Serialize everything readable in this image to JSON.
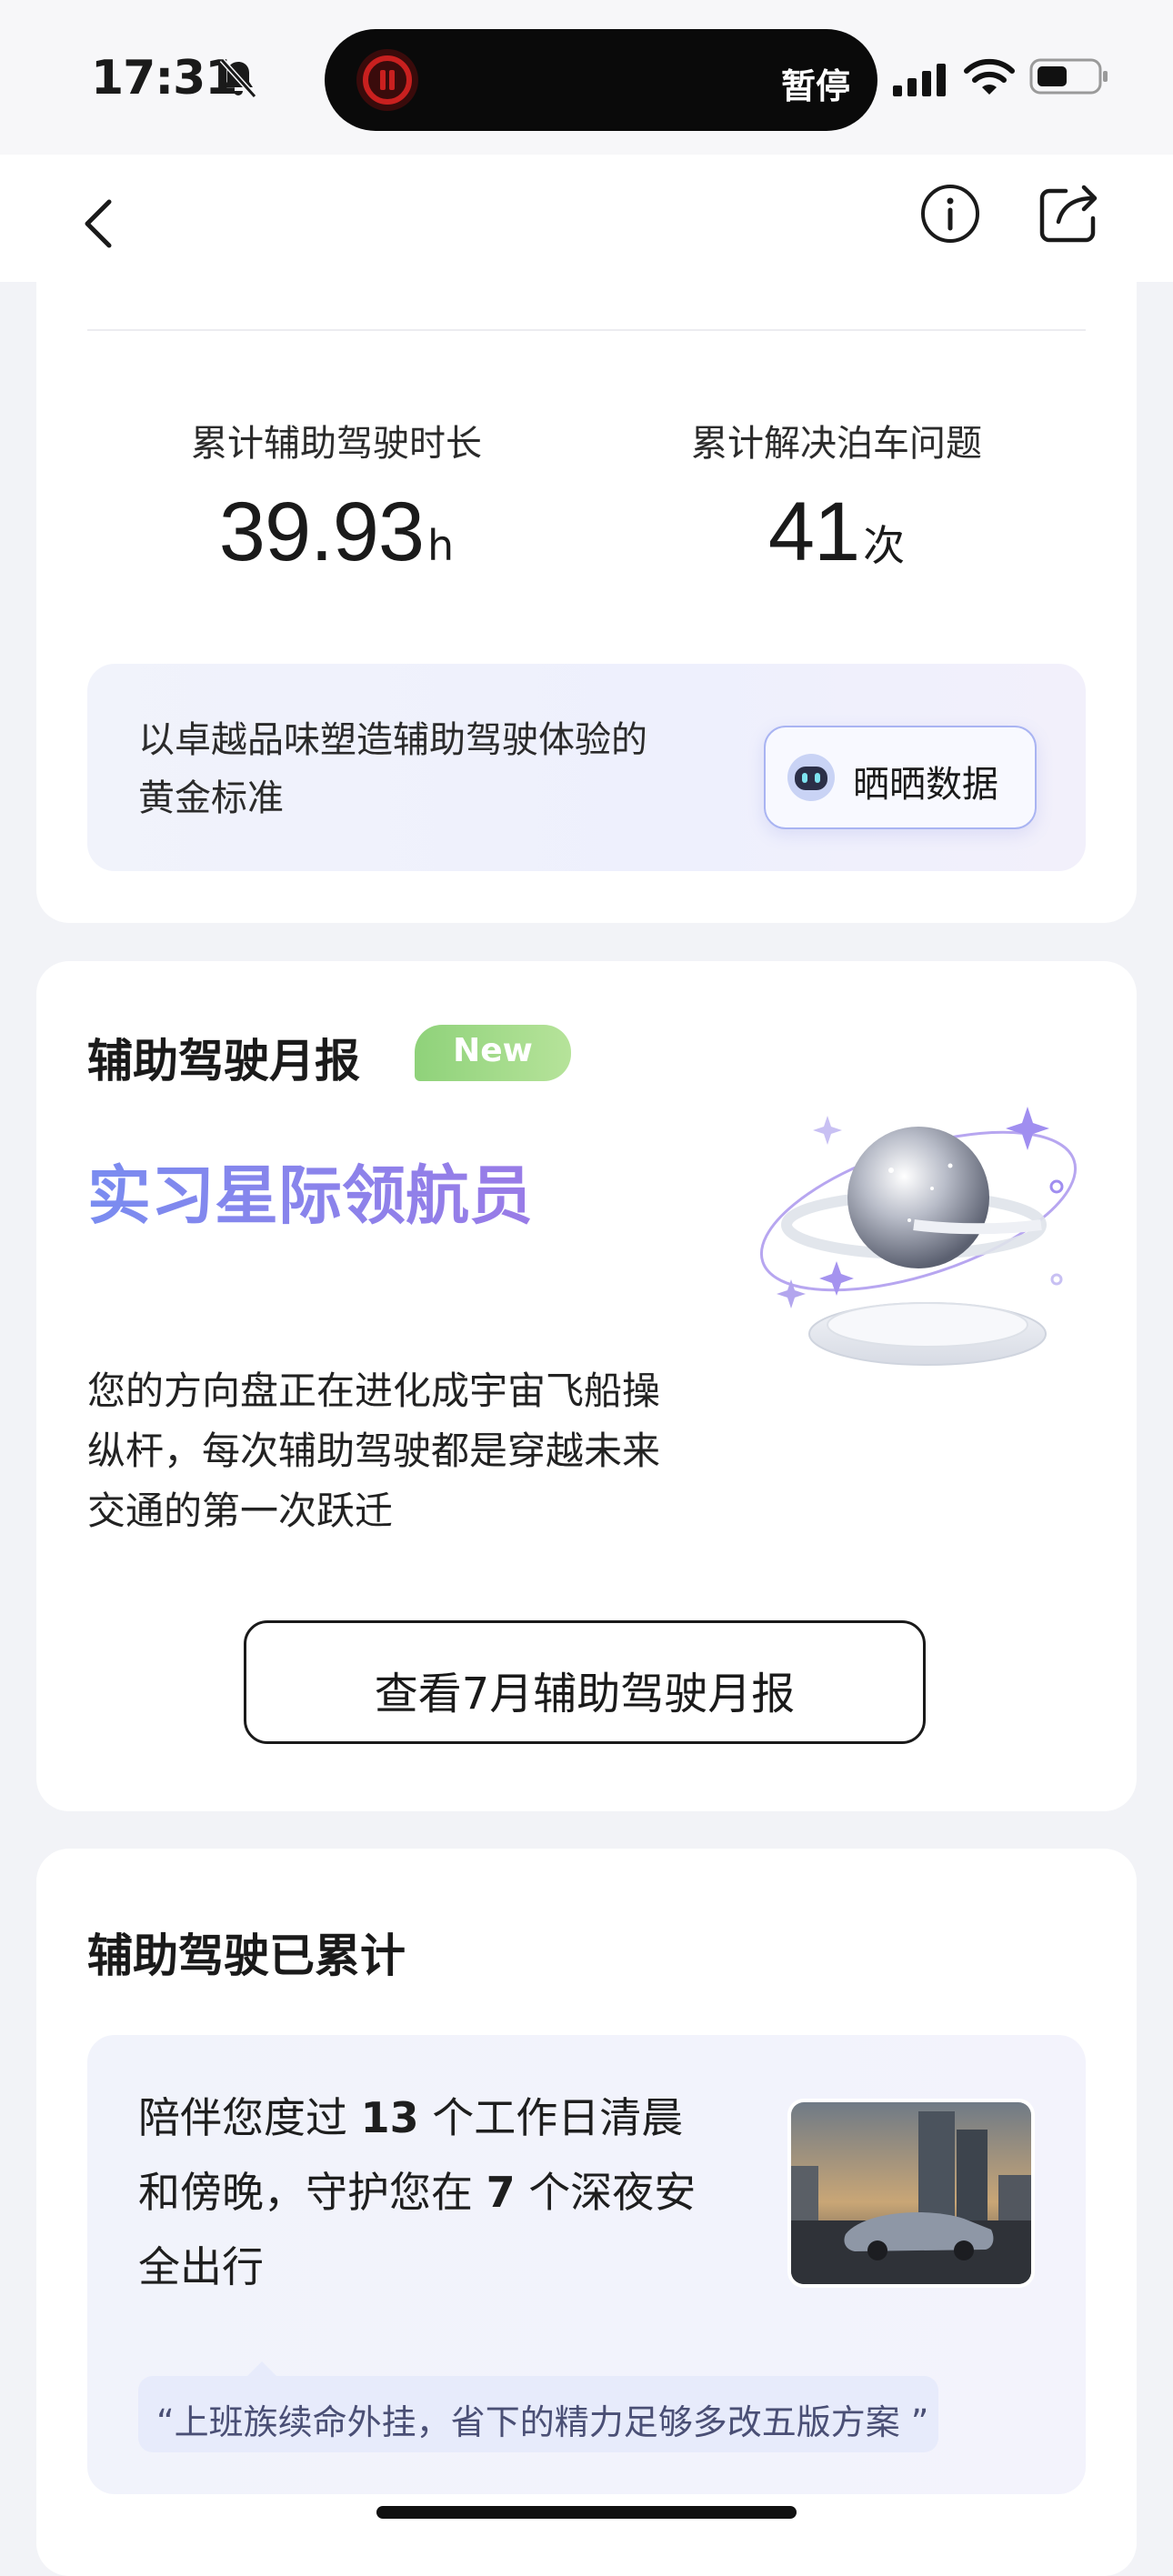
{
  "status_bar": {
    "time": "17:31",
    "island_label": "暂停"
  },
  "stats": {
    "duration_label": "累计辅助驾驶时长",
    "duration_value": "39.93",
    "duration_unit": "h",
    "parking_label": "累计解决泊车问题",
    "parking_value": "41",
    "parking_unit": "次"
  },
  "promo": {
    "text": "以卓越品味塑造辅助驾驶体验的黄金标准",
    "button_label": "晒晒数据"
  },
  "monthly_report": {
    "title": "辅助驾驶月报",
    "badge": "New",
    "headline": "实习星际领航员",
    "description": "您的方向盘正在进化成宇宙飞船操纵杆，每次辅助驾驶都是穿越未来交通的第一次跃迁",
    "button_label": "查看7月辅助驾驶月报"
  },
  "cumulative": {
    "title": "辅助驾驶已累计",
    "text_1": "陪伴您度过 ",
    "workdays": "13",
    "text_2": " 个工作日清晨和傍晚，守护您在 ",
    "late_nights": "7",
    "text_3": " 个深夜安全出行",
    "quote": "“上班族续命外挂，省下的精力足够多改五版方案 ”"
  },
  "colors": {
    "headline_gradient_start": "#7a8cf0",
    "headline_gradient_end": "#9b7ae6",
    "badge_green": "#8fd27a",
    "button_border": "#a9b4f2"
  },
  "icons": [
    "bell-mute-icon",
    "record-pause-icon",
    "signal-icon",
    "wifi-icon",
    "battery-icon",
    "back-icon",
    "info-icon",
    "share-icon",
    "robot-icon"
  ]
}
